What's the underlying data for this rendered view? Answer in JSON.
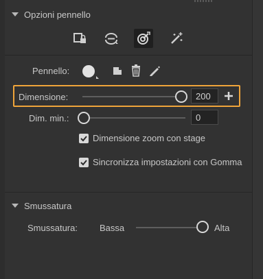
{
  "brush_options": {
    "title": "Opzioni pennello",
    "tools": [
      {
        "icon": "lock-brush-icon",
        "active": false
      },
      {
        "icon": "brush-behind-icon",
        "active": false
      },
      {
        "icon": "brush-target-icon",
        "active": true
      },
      {
        "icon": "magic-brush-icon",
        "active": false
      }
    ],
    "brush_label": "Pennello:",
    "size": {
      "label": "Dimensione:",
      "value": "200",
      "slider_fraction": 0.95
    },
    "min_size": {
      "label": "Dim. min.:",
      "value": "0",
      "slider_fraction": 0.0
    },
    "zoom_checkbox": {
      "label": "Dimensione zoom con stage",
      "checked": true
    },
    "eraser_checkbox": {
      "label": "Sincronizza impostazioni con Gomma",
      "checked": true
    }
  },
  "smoothing": {
    "title": "Smussatura",
    "label": "Smussatura:",
    "low_label": "Bassa",
    "high_label": "Alta",
    "slider_fraction": 1.0
  },
  "colors": {
    "panel_bg": "#323232",
    "highlight": "#f0a53a",
    "text": "#c8c8c8"
  }
}
